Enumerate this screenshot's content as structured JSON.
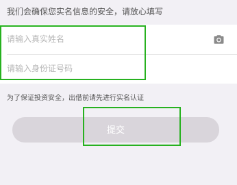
{
  "notice_text": "我们会确保您实名信息的安全，请放心填写",
  "form": {
    "name_placeholder": "请输入真实姓名",
    "id_placeholder": "请输入身份证号码",
    "camera_icon": "camera-icon"
  },
  "hint_text": "为了保证投资安全，出借前请先进行实名认证",
  "submit_label": "提交",
  "colors": {
    "background": "#f2f0f5",
    "button_disabled": "#d9d5db",
    "highlight_box": "#27b11f"
  }
}
